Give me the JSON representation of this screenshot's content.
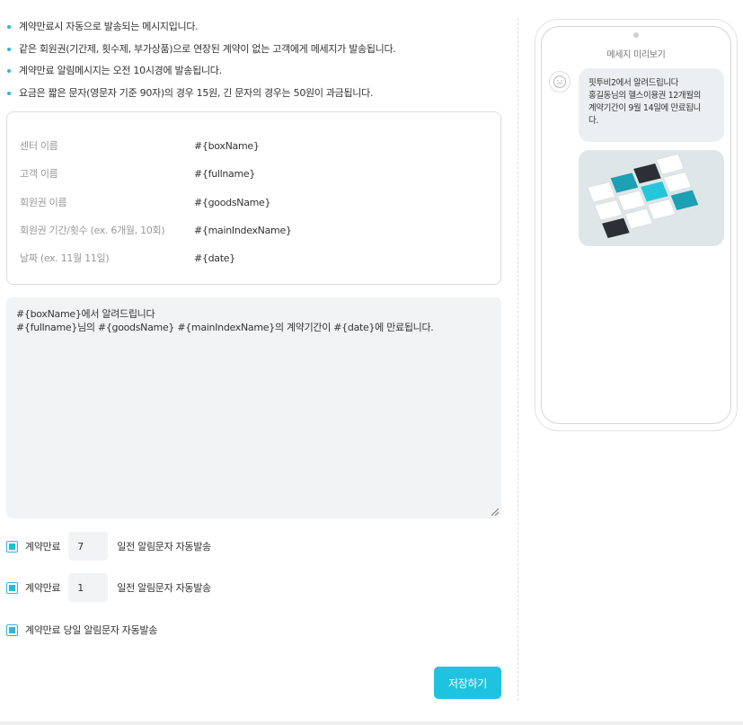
{
  "notes": [
    "계약만료시 자동으로 발송되는 메시지입니다.",
    "같은 회원권(기간제, 횟수제, 부가상품)으로 연장된 계약이 없는 고객에게 메세지가 발송됩니다.",
    "계약만료 알림메시지는 오전 10시경에 발송됩니다.",
    "요금은 짧은 문자(영문자 기준 90자)의 경우 15원, 긴 문자의 경우는 50원이 과금됩니다."
  ],
  "variables": [
    {
      "label": "센터 이름",
      "value": "#{boxName}"
    },
    {
      "label": "고객 이름",
      "value": "#{fullname}"
    },
    {
      "label": "회원권 이름",
      "value": "#{goodsName}"
    },
    {
      "label": "회원권 기간/횟수 (ex. 6개월, 10회)",
      "value": "#{mainIndexName}"
    },
    {
      "label": "날짜 (ex. 11월 11일)",
      "value": "#{date}"
    }
  ],
  "message_template": {
    "line1": "#{boxName}에서 알려드립니다",
    "line2": "#{fullname}님의 #{goodsName} #{mainIndexName}의 계약기간이 #{date}에 만료됩니다."
  },
  "options": [
    {
      "checked": true,
      "prefix": "계약만료",
      "days": "7",
      "suffix": "일전 알림문자 자동발송"
    },
    {
      "checked": true,
      "prefix": "계약만료",
      "days": "1",
      "suffix": "일전 알림문자 자동발송"
    },
    {
      "checked": true,
      "label": "계약만료 당일 알림문자 자동발송"
    }
  ],
  "save_label": "저장하기",
  "preview": {
    "title": "메세지 미리보기",
    "lines": [
      "핏투비2에서 알려드립니다",
      "홍길동님의 헬스이용권 12개월의",
      "계약기간이 9월 14일에 만료됩니",
      "다."
    ]
  },
  "colors": {
    "accent": "#22bcd6",
    "button": "#1fc3df",
    "input_bg": "#f2f3f5",
    "bubble_bg": "#eceff1"
  }
}
